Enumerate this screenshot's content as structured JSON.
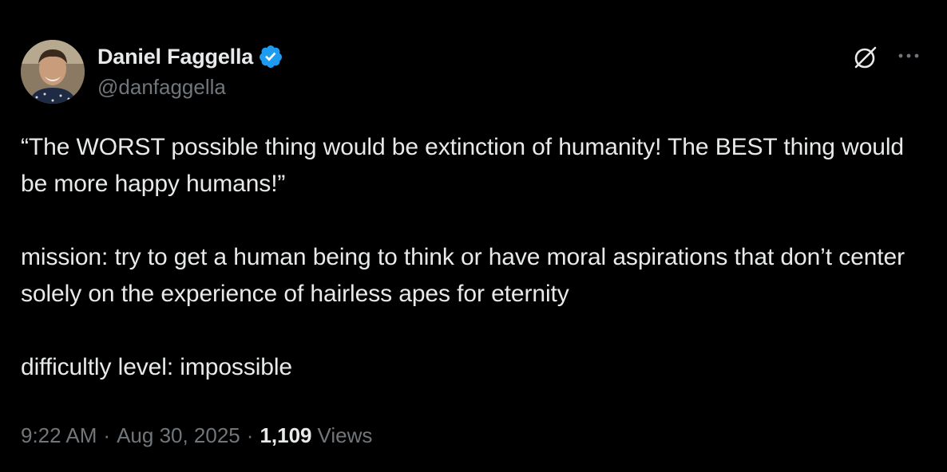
{
  "author": {
    "display_name": "Daniel Faggella",
    "handle": "@danfaggella",
    "verified_icon": "verified-badge-icon",
    "avatar_icon": "avatar-photo"
  },
  "actions": {
    "grok_icon": "grok-icon",
    "more_icon": "more-dots-icon"
  },
  "tweet": {
    "text": "“The WORST possible thing would be extinction of humanity! The BEST thing would be more happy humans!”\n\nmission: try to get a human being to think or have moral aspirations that don’t center solely on the experience of hairless apes for eternity\n\ndifficultly level: impossible"
  },
  "meta": {
    "time": "9:22 AM",
    "separator": "·",
    "date": "Aug 30, 2025",
    "views_count": "1,109",
    "views_label": "Views"
  },
  "colors": {
    "background": "#000000",
    "text": "#e7e9ea",
    "secondary": "#71767b",
    "verified": "#1d9bf0"
  }
}
